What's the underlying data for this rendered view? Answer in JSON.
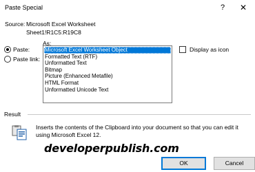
{
  "dialog": {
    "title": "Paste Special",
    "help": "?",
    "close": "✕"
  },
  "source": {
    "label": "Source:",
    "value": "Microsoft Excel Worksheet",
    "ref": "Sheet1!R1C5:R19C8"
  },
  "options": {
    "as_label": "As:",
    "paste_label": "Paste:",
    "paste_link_label": "Paste link:",
    "selected_mode": "paste",
    "display_as_icon_label": "Display as icon",
    "display_as_icon_checked": false
  },
  "formats": [
    "Microsoft Excel Worksheet Object",
    "Formatted Text (RTF)",
    "Unformatted Text",
    "Bitmap",
    "Picture (Enhanced Metafile)",
    "HTML Format",
    "Unformatted Unicode Text"
  ],
  "selected_format_index": 0,
  "result": {
    "label": "Result",
    "text": "Inserts the contents of the Clipboard into your document so that you can edit it using Microsoft Excel 12.",
    "icon": "paste-result-icon"
  },
  "watermark": "developerpublish.com",
  "buttons": {
    "ok": "OK",
    "cancel": "Cancel"
  },
  "colors": {
    "selection": "#0078d7"
  }
}
